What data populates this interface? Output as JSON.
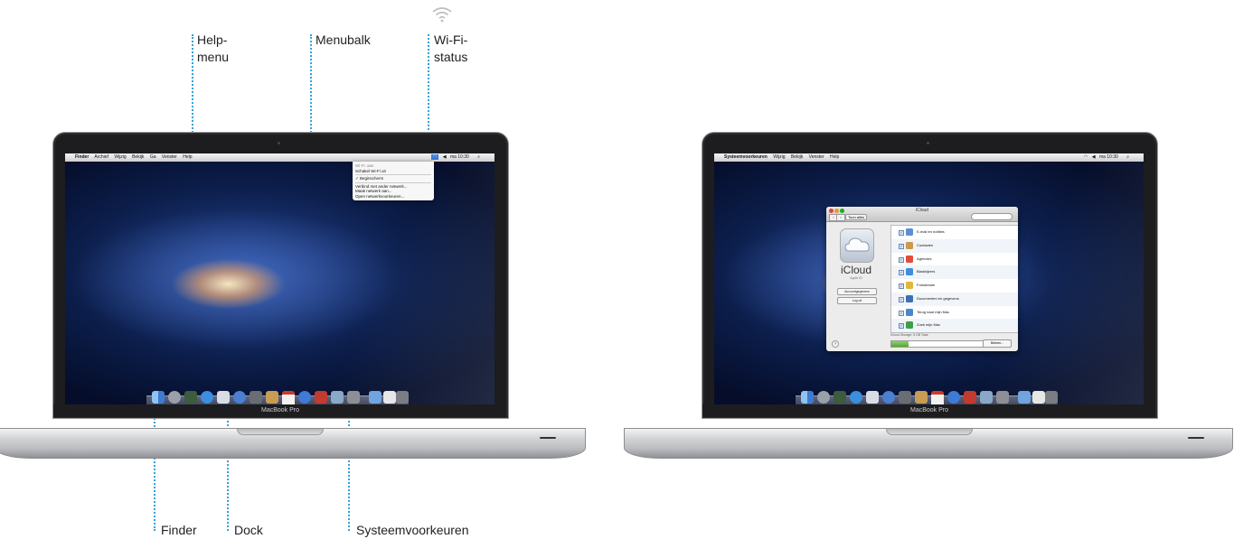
{
  "callouts": {
    "help_menu": "Help-\nmenu",
    "menubar": "Menubalk",
    "wifi_status": "Wi-Fi-\nstatus",
    "finder": "Finder",
    "dock": "Dock",
    "system_prefs": "Systeemvoorkeuren"
  },
  "laptop_left": {
    "brand_label": "MacBook Pro",
    "menubar": {
      "apple": "",
      "items": [
        "Finder",
        "Archief",
        "Wijzig",
        "Bekijk",
        "Ga",
        "Venster",
        "Help"
      ],
      "clock": "ma 10:30"
    },
    "wifi_menu": {
      "items": [
        "Wi-Fi: aan",
        "Schakel Wi-Fi uit",
        "Beginscherm",
        "Verbind met ander netwerk...",
        "Maak netwerk aan...",
        "Open netwerkvoorkeuren..."
      ]
    }
  },
  "laptop_right": {
    "brand_label": "MacBook Pro",
    "menubar": {
      "apple": "",
      "items": [
        "Systeemvoorkeuren",
        "Wijzig",
        "Bekijk",
        "Venster",
        "Help"
      ],
      "clock": "ma 10:30"
    },
    "icloud_window": {
      "title": "iCloud",
      "show_all": "Toon alles",
      "app_name": "iCloud",
      "apple_id": "Apple ID",
      "account_details": "Accountgegevens",
      "log_out": "Log uit",
      "help": "?",
      "services": [
        {
          "label": "E-mail en notities",
          "color": "#5b8fd6",
          "checked": true
        },
        {
          "label": "Contacten",
          "color": "#c99a4a",
          "checked": true
        },
        {
          "label": "Agenda's",
          "color": "#e14b3b",
          "checked": true
        },
        {
          "label": "Bladwijzers",
          "color": "#3f8edc",
          "checked": true
        },
        {
          "label": "Fotostream",
          "color": "#e0b83a",
          "checked": true
        },
        {
          "label": "Documenten en gegevens",
          "color": "#3c6fb8",
          "checked": true
        },
        {
          "label": "Terug naar mijn Mac",
          "color": "#4a86d0",
          "checked": true
        },
        {
          "label": "Zoek mijn Mac",
          "color": "#3aa04a",
          "checked": true
        }
      ],
      "storage_text": "iCloud Storage: 5 GB Total",
      "storage_used_fraction": 0.18,
      "manage_button": "Beheer..."
    }
  }
}
